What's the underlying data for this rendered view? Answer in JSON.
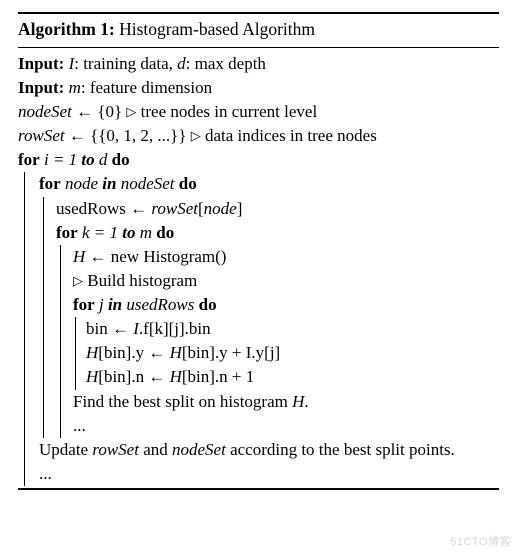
{
  "title_label": "Algorithm 1:",
  "title_text": "Histogram-based Algorithm",
  "lines": {
    "input1_lbl": "Input:",
    "input1_a": "I",
    "input1_b": ": training data, ",
    "input1_c": "d",
    "input1_d": ": max depth",
    "input2_lbl": "Input:",
    "input2_a": "m",
    "input2_b": ": feature dimension",
    "nodeset_a": "nodeSet",
    "nodeset_b": " ← {0} ",
    "nodeset_c": "tree nodes in current level",
    "rowset_a": "rowSet",
    "rowset_b": " ← {{0, 1, 2, ...}} ",
    "rowset_c": "data indices in tree nodes",
    "for_i_a": "for",
    "for_i_b": " i = 1 ",
    "for_i_c": "to",
    "for_i_d": " d ",
    "for_i_e": "do",
    "for_node_a": "for",
    "for_node_b": " node ",
    "for_node_c": "in",
    "for_node_d": " nodeSet ",
    "for_node_e": "do",
    "usedrows_a": "usedRows ← ",
    "usedrows_b": "rowSet",
    "usedrows_c": "[",
    "usedrows_d": "node",
    "usedrows_e": "]",
    "for_k_a": "for",
    "for_k_b": " k = 1 ",
    "for_k_c": "to",
    "for_k_d": " m ",
    "for_k_e": "do",
    "hnew_a": "H",
    "hnew_b": " ← new   Histogram()",
    "build": "Build histogram",
    "for_j_a": "for",
    "for_j_b": " j ",
    "for_j_c": "in",
    "for_j_d": " usedRows ",
    "for_j_e": "do",
    "bin_a": "bin ← ",
    "bin_b": "I",
    "bin_c": ".f[k][j].bin",
    "hy_a": "H",
    "hy_b": "[bin].y ← ",
    "hy_c": "H",
    "hy_d": "[bin].y + I.y[j]",
    "hn_a": "H",
    "hn_b": "[bin].n ← ",
    "hn_c": "H",
    "hn_d": "[bin].n + 1",
    "find_a": "Find the best split on histogram ",
    "find_b": "H",
    "find_c": ".",
    "dots1": "...",
    "update_a": "Update ",
    "update_b": "rowSet",
    "update_c": " and ",
    "update_d": "nodeSet",
    "update_e": " according to the best split points.",
    "dots2": "..."
  },
  "tri": "▷",
  "watermark": "51CTO博客"
}
